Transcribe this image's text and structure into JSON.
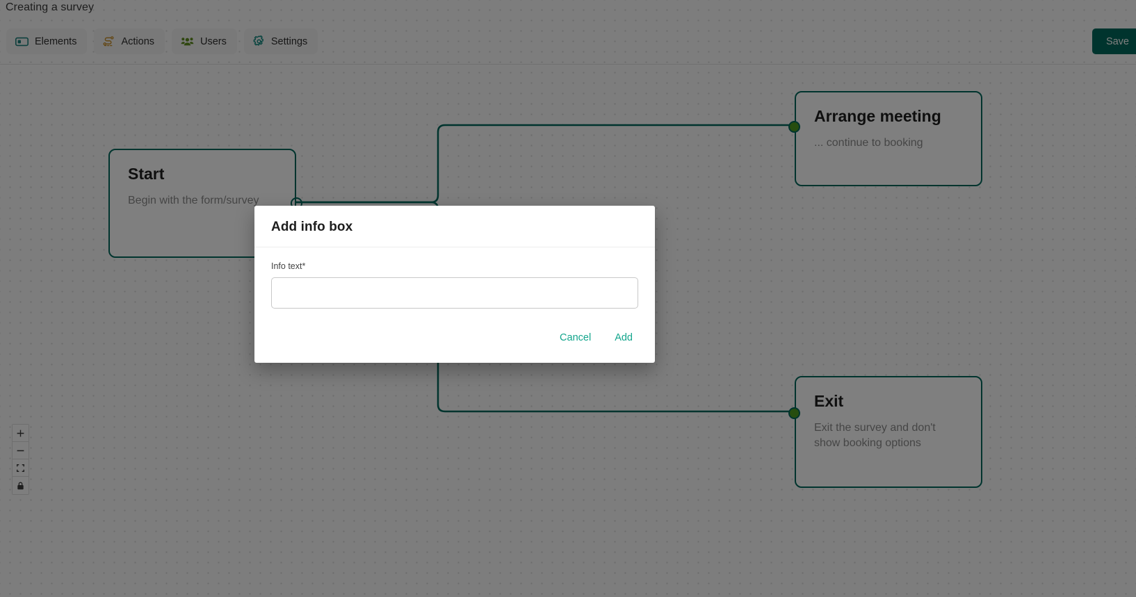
{
  "header": {
    "title": "Creating a survey",
    "toolbar": [
      {
        "label": "Elements",
        "icon": "rectangle-element-icon",
        "color": "#1a7f7a"
      },
      {
        "label": "Actions",
        "icon": "actions-flow-icon",
        "color": "#c8912c"
      },
      {
        "label": "Users",
        "icon": "users-group-icon",
        "color": "#5e8c1f"
      },
      {
        "label": "Settings",
        "icon": "gear-icon",
        "color": "#12887f"
      }
    ],
    "save_label": "Save"
  },
  "canvas": {
    "nodes": [
      {
        "id": "start",
        "title": "Start",
        "description": "Begin with the form/survey",
        "border_color": "#00695c"
      },
      {
        "id": "arrange-meeting",
        "title": "Arrange meeting",
        "description": "... continue to booking",
        "border_color": "#00695c"
      },
      {
        "id": "exit",
        "title": "Exit",
        "description": "Exit the survey and don't show booking options",
        "border_color": "#00695c"
      }
    ],
    "handle_colors": {
      "source": "#00695c",
      "target": "#4d9b1f"
    },
    "edge_color": "#00695c"
  },
  "controls": {
    "zoom_in": "+",
    "zoom_out": "−",
    "fit_view": "fit-view",
    "lock": "lock"
  },
  "modal": {
    "title": "Add info box",
    "field_label": "Info text*",
    "field_value": "",
    "field_placeholder": "",
    "cancel_label": "Cancel",
    "add_label": "Add",
    "accent_color": "#12a58c"
  }
}
